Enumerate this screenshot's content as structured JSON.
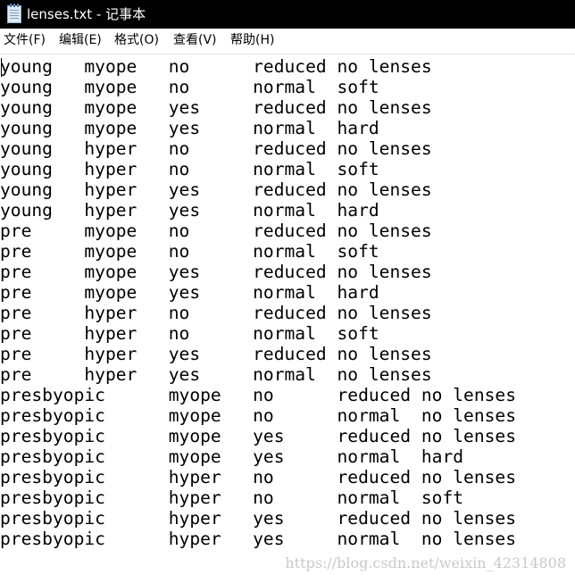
{
  "window": {
    "title": "lenses.txt - 记事本",
    "icon": "notepad-icon"
  },
  "menu": [
    {
      "label": "文件(F)"
    },
    {
      "label": "编辑(E)"
    },
    {
      "label": "格式(O)"
    },
    {
      "label": "查看(V)"
    },
    {
      "label": "帮助(H)"
    }
  ],
  "document": {
    "lines": [
      "young\tmyope\tno\treduced\tno lenses",
      "young\tmyope\tno\tnormal\tsoft",
      "young\tmyope\tyes\treduced\tno lenses",
      "young\tmyope\tyes\tnormal\thard",
      "young\thyper\tno\treduced\tno lenses",
      "young\thyper\tno\tnormal\tsoft",
      "young\thyper\tyes\treduced\tno lenses",
      "young\thyper\tyes\tnormal\thard",
      "pre\tmyope\tno\treduced\tno lenses",
      "pre\tmyope\tno\tnormal\tsoft",
      "pre\tmyope\tyes\treduced\tno lenses",
      "pre\tmyope\tyes\tnormal\thard",
      "pre\thyper\tno\treduced\tno lenses",
      "pre\thyper\tno\tnormal\tsoft",
      "pre\thyper\tyes\treduced\tno lenses",
      "pre\thyper\tyes\tnormal\tno lenses",
      "presbyopic\tmyope\tno\treduced\tno lenses",
      "presbyopic\tmyope\tno\tnormal\tno lenses",
      "presbyopic\tmyope\tyes\treduced\tno lenses",
      "presbyopic\tmyope\tyes\tnormal\thard",
      "presbyopic\thyper\tno\treduced\tno lenses",
      "presbyopic\thyper\tno\tnormal\tsoft",
      "presbyopic\thyper\tyes\treduced\tno lenses",
      "presbyopic\thyper\tyes\tnormal\tno lenses"
    ]
  },
  "watermark": "https://blog.csdn.net/weixin_42314808"
}
